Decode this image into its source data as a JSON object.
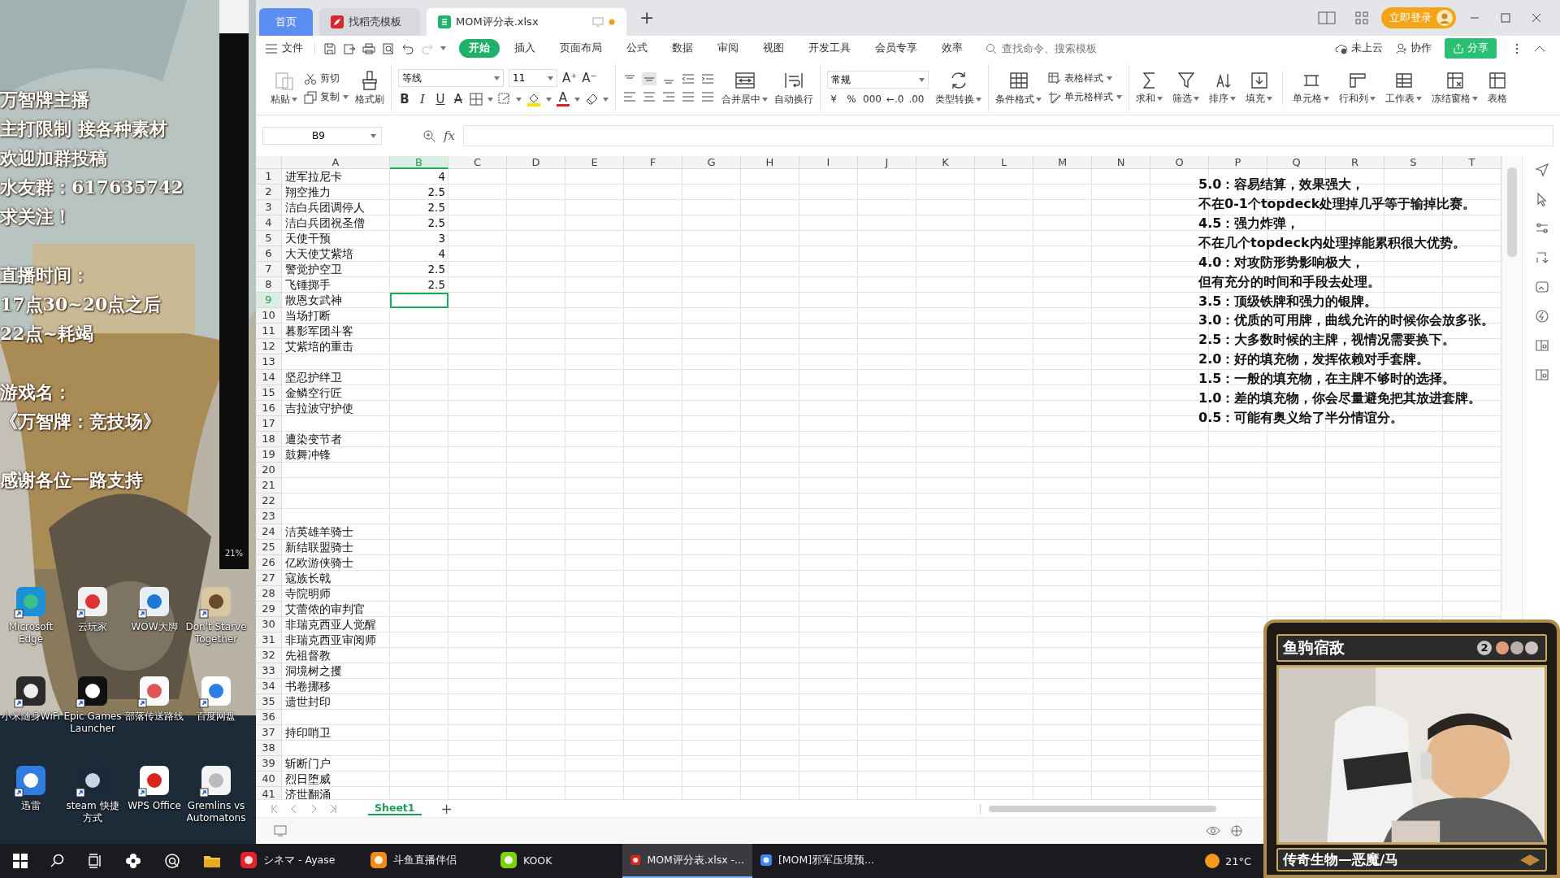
{
  "desktop": {
    "overlay_groups": [
      {
        "lines": [
          "万智牌主播",
          "主打限制 接各种素材",
          "欢迎加群投稿",
          "水友群：617635742",
          "求关注！"
        ]
      },
      {
        "lines": [
          "直播时间：",
          "17点30~20点之后",
          "22点~耗竭"
        ]
      },
      {
        "lines": [
          "游戏名：",
          "《万智牌：竞技场》"
        ]
      },
      {
        "lines": [
          "感谢各位一路支持"
        ]
      }
    ],
    "side_window": {
      "zoom": "21%"
    },
    "icons": [
      {
        "label": "Microsoft Edge",
        "kind": "swirl"
      },
      {
        "label": "云玩家",
        "kind": "player"
      },
      {
        "label": "WOW大脚",
        "kind": "window"
      },
      {
        "label": "Don't Starve Together",
        "kind": "figure"
      },
      {
        "label": "小米随身WiFi",
        "kind": "wifi"
      },
      {
        "label": "Epic Games Launcher",
        "kind": "tile"
      },
      {
        "label": "部落传送路线",
        "kind": "chart"
      },
      {
        "label": "百度网盘",
        "kind": "cloud"
      },
      {
        "label": "迅雷",
        "kind": "bird"
      },
      {
        "label": "steam 快捷方式",
        "kind": "steam"
      },
      {
        "label": "WPS Office",
        "kind": "wps"
      },
      {
        "label": "Gremlins vs Automatons",
        "kind": "document"
      }
    ]
  },
  "wps": {
    "tabs": [
      {
        "label": "首页",
        "kind": "home",
        "selected": false
      },
      {
        "label": "找稻壳模板",
        "kind": "template",
        "selected": false
      },
      {
        "label": "MOM评分表.xlsx",
        "kind": "sheet",
        "selected": true
      }
    ],
    "new_tab": "+",
    "login_button": "立即登录",
    "file_menu": "文件",
    "menu": [
      {
        "label": "开始",
        "selected": true
      },
      {
        "label": "插入",
        "selected": false
      },
      {
        "label": "页面布局",
        "selected": false
      },
      {
        "label": "公式",
        "selected": false
      },
      {
        "label": "数据",
        "selected": false
      },
      {
        "label": "审阅",
        "selected": false
      },
      {
        "label": "视图",
        "selected": false
      },
      {
        "label": "开发工具",
        "selected": false
      },
      {
        "label": "会员专享",
        "selected": false
      },
      {
        "label": "效率",
        "selected": false
      }
    ],
    "search": {
      "placeholder": "查找命令、搜索模板"
    },
    "cloud_status": "未上云",
    "collaborate": "协作",
    "share_button": "分享",
    "ribbon": {
      "clipboard": {
        "paste": "粘贴",
        "cut": "剪切",
        "copy": "复制",
        "format_painter": "格式刷"
      },
      "font": {
        "name": "等线",
        "size": "11",
        "grow": "A⁺",
        "shrink": "A⁻",
        "styles": [
          {
            "label": "B",
            "kind": "bold"
          },
          {
            "label": "I",
            "kind": "italic"
          },
          {
            "label": "U",
            "kind": "underline"
          },
          {
            "label": "A",
            "kind": "strike"
          }
        ],
        "font_color": "A"
      },
      "alignment": {
        "merge": "合并居中",
        "wrap": "自动换行"
      },
      "number": {
        "format": "常规",
        "symbols": [
          "¥",
          "%",
          "000",
          "←.0",
          ".00"
        ],
        "convert": "类型转换"
      },
      "styles": {
        "conditional": "条件格式",
        "table_style": "表格样式",
        "cell_style": "单元格样式"
      },
      "tools": [
        "求和",
        "筛选",
        "排序",
        "填充",
        "单元格",
        "行和列",
        "工作表",
        "冻结窗格",
        "表格"
      ]
    },
    "sheet": {
      "name_box": "B9",
      "fx": "fx",
      "columns": [
        {
          "label": "A",
          "selected": false
        },
        {
          "label": "B",
          "selected": true
        },
        {
          "label": "C",
          "selected": false
        },
        {
          "label": "D",
          "selected": false
        },
        {
          "label": "E",
          "selected": false
        },
        {
          "label": "F",
          "selected": false
        },
        {
          "label": "G",
          "selected": false
        },
        {
          "label": "H",
          "selected": false
        },
        {
          "label": "I",
          "selected": false
        },
        {
          "label": "J",
          "selected": false
        },
        {
          "label": "K",
          "selected": false
        },
        {
          "label": "L",
          "selected": false
        },
        {
          "label": "M",
          "selected": false
        },
        {
          "label": "N",
          "selected": false
        },
        {
          "label": "O",
          "selected": false
        },
        {
          "label": "P",
          "selected": false
        },
        {
          "label": "Q",
          "selected": false
        },
        {
          "label": "R",
          "selected": false
        },
        {
          "label": "S",
          "selected": false
        },
        {
          "label": "T",
          "selected": false
        }
      ],
      "rows": [
        {
          "n": "1",
          "a": "进军拉尼卡",
          "b": "4",
          "selected": false
        },
        {
          "n": "2",
          "a": "翔空推力",
          "b": "2.5",
          "selected": false
        },
        {
          "n": "3",
          "a": "洁白兵团调停人",
          "b": "2.5",
          "selected": false
        },
        {
          "n": "4",
          "a": "洁白兵团祝圣僧",
          "b": "2.5",
          "selected": false
        },
        {
          "n": "5",
          "a": "天使干预",
          "b": "3",
          "selected": false
        },
        {
          "n": "6",
          "a": "大天使艾紫培",
          "b": "4",
          "selected": false
        },
        {
          "n": "7",
          "a": "警觉护空卫",
          "b": "2.5",
          "selected": false
        },
        {
          "n": "8",
          "a": "飞锤掷手",
          "b": "2.5",
          "selected": false
        },
        {
          "n": "9",
          "a": "散恩女武神",
          "selected": true
        },
        {
          "n": "10",
          "a": "当场打断",
          "selected": false
        },
        {
          "n": "11",
          "a": "暮影军团斗客",
          "selected": false
        },
        {
          "n": "12",
          "a": "艾紫培的重击",
          "selected": false
        },
        {
          "n": "13",
          "selected": false
        },
        {
          "n": "14",
          "a": "坚忍护绊卫",
          "selected": false
        },
        {
          "n": "15",
          "a": "金鳞空行匠",
          "selected": false
        },
        {
          "n": "16",
          "a": "吉拉波守护使",
          "selected": false
        },
        {
          "n": "17",
          "selected": false
        },
        {
          "n": "18",
          "a": "遭染变节者",
          "selected": false
        },
        {
          "n": "19",
          "a": "鼓舞冲锋",
          "selected": false
        },
        {
          "n": "20",
          "selected": false
        },
        {
          "n": "21",
          "selected": false
        },
        {
          "n": "22",
          "selected": false
        },
        {
          "n": "23",
          "selected": false
        },
        {
          "n": "24",
          "a": "洁英雄羊骑士",
          "selected": false
        },
        {
          "n": "25",
          "a": "新结联盟骑士",
          "selected": false
        },
        {
          "n": "26",
          "a": "亿欧游侠骑士",
          "selected": false
        },
        {
          "n": "27",
          "a": "寇族长戟",
          "selected": false
        },
        {
          "n": "28",
          "a": "寺院明师",
          "selected": false
        },
        {
          "n": "29",
          "a": "艾蕾侬的审判官",
          "selected": false
        },
        {
          "n": "30",
          "a": "非瑞克西亚人觉醒",
          "selected": false
        },
        {
          "n": "31",
          "a": "非瑞克西亚审阅师",
          "selected": false
        },
        {
          "n": "32",
          "a": "先祖督教",
          "selected": false
        },
        {
          "n": "33",
          "a": "洞境树之攫",
          "selected": false
        },
        {
          "n": "34",
          "a": "书卷挪移",
          "selected": false
        },
        {
          "n": "35",
          "a": "遗世封印",
          "selected": false
        },
        {
          "n": "36",
          "selected": false
        },
        {
          "n": "37",
          "a": "持印哨卫",
          "selected": false
        },
        {
          "n": "38",
          "selected": false
        },
        {
          "n": "39",
          "a": "斩断门户",
          "selected": false
        },
        {
          "n": "40",
          "a": "烈日堕威",
          "selected": false
        },
        {
          "n": "41",
          "a": "济世翻涌",
          "selected": false
        }
      ],
      "notes": [
        "5.0：容易结算，效果强大，",
        "不在0-1个topdeck处理掉几乎等于输掉比赛。",
        "4.5：强力炸弹，",
        "不在几个topdeck内处理掉能累积很大优势。",
        "4.0：对攻防形势影响极大，",
        "但有充分的时间和手段去处理。",
        "3.5：顶级铁牌和强力的银牌。",
        "3.0：优质的可用牌，曲线允许的时候你会放多张。",
        "2.5：大多数时候的主牌，视情况需要换下。",
        "2.0：好的填充物，发挥依赖对手套牌。",
        "1.5：一般的填充物，在主牌不够时的选择。",
        "1.0：差的填充物，你会尽量避免把其放进套牌。",
        "0.5：可能有奥义给了半分情谊分。"
      ]
    },
    "sheet_tabs": [
      {
        "label": "Sheet1",
        "selected": true
      }
    ],
    "add_sheet": "+"
  },
  "webcam": {
    "title": "鱼驹宿敌",
    "mana_cost": "2",
    "type_line": "传奇生物—恶魔/马"
  },
  "taskbar": {
    "tasks": [
      {
        "label": "シネマ - Ayase",
        "kind": "music",
        "selected": false
      },
      {
        "label": "斗鱼直播伴侣",
        "kind": "stream",
        "selected": false
      },
      {
        "label": "KOOK",
        "kind": "chat",
        "selected": false
      },
      {
        "label": "MOM评分表.xlsx -...",
        "kind": "spreadsheet",
        "selected": true
      },
      {
        "label": "[MOM]邪军压境预...",
        "kind": "browser",
        "selected": false
      }
    ],
    "temperature": "21°C"
  }
}
